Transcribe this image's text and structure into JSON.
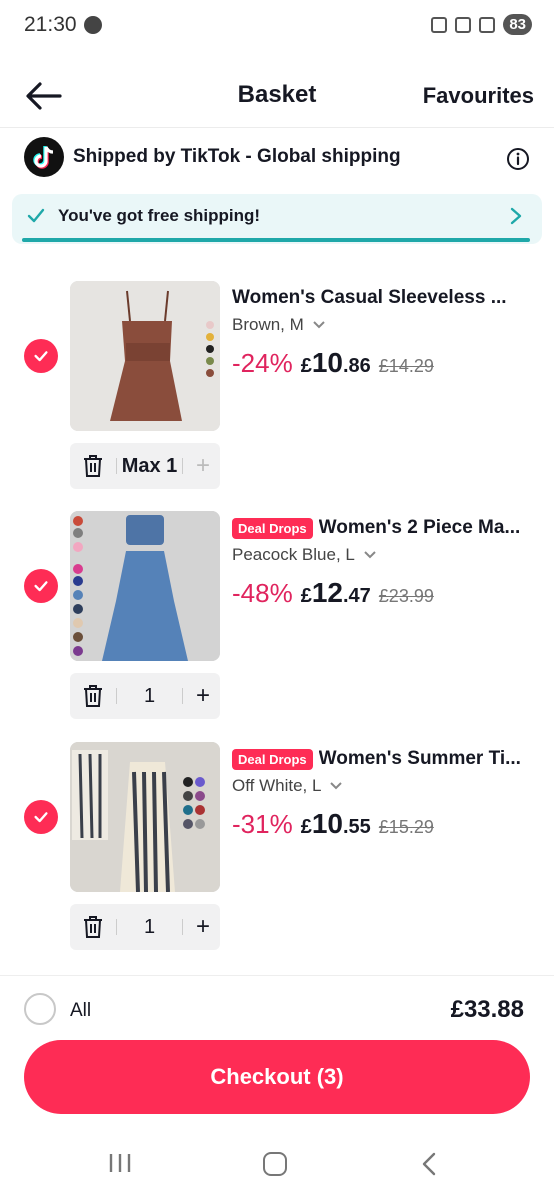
{
  "status_bar": {
    "time": "21:30",
    "battery": "83"
  },
  "header": {
    "title": "Basket",
    "favourites_label": "Favourites"
  },
  "shipping": {
    "label": "Shipped by TikTok - Global shipping"
  },
  "free_shipping": {
    "text": "You've got free shipping!",
    "progress": 1.0,
    "accent": "#1fa8a9"
  },
  "items": [
    {
      "badge": "",
      "title": "Women's Casual Sleeveless ...",
      "variant": "Brown, M",
      "discount": "-24%",
      "currency": "£",
      "price_int": "10",
      "price_dec": ".86",
      "old_price": "£14.29",
      "quantity": "Max 1",
      "plus_disabled": true,
      "selected": true
    },
    {
      "badge": "Deal Drops",
      "title": "Women's 2 Piece Ma...",
      "variant": "Peacock Blue, L",
      "discount": "-48%",
      "currency": "£",
      "price_int": "12",
      "price_dec": ".47",
      "old_price": "£23.99",
      "quantity": "1",
      "plus_disabled": false,
      "selected": true
    },
    {
      "badge": "Deal Drops",
      "title": "Women's Summer Ti...",
      "variant": "Off White, L",
      "discount": "-31%",
      "currency": "£",
      "price_int": "10",
      "price_dec": ".55",
      "old_price": "£15.29",
      "quantity": "1",
      "plus_disabled": false,
      "selected": true
    }
  ],
  "footer": {
    "all_label": "All",
    "total": "£33.88",
    "checkout_label": "Checkout (3)"
  },
  "colors": {
    "accent": "#fe2c55",
    "discount": "#e0245e",
    "banner_bg": "#eaf7f8"
  },
  "icons": [
    "back-arrow-icon",
    "tiktok-logo-icon",
    "info-icon",
    "check-icon",
    "chevron-right-icon",
    "chevron-down-icon",
    "trash-icon",
    "plus-icon",
    "checkbox-checked-icon"
  ]
}
